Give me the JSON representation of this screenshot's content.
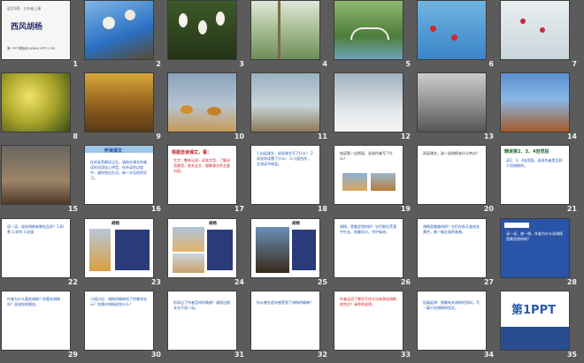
{
  "slides": [
    {
      "num": "1",
      "title": "西风胡杨",
      "top": "语文S版 · 五年级上册",
      "url": "第一PPT模板网-WWW.1PPT.COM"
    },
    {
      "num": "2"
    },
    {
      "num": "3"
    },
    {
      "num": "4"
    },
    {
      "num": "5"
    },
    {
      "num": "6"
    },
    {
      "num": "7"
    },
    {
      "num": "8"
    },
    {
      "num": "9"
    },
    {
      "num": "10"
    },
    {
      "num": "11"
    },
    {
      "num": "12"
    },
    {
      "num": "13"
    },
    {
      "num": "14"
    },
    {
      "num": "15"
    },
    {
      "num": "16",
      "head": "听读课文",
      "text": "在听录音朗读之后，请你在课文的难读的词语加上拼音，在听读的过程中，请你划出生词，每一次无扰的学习。"
    },
    {
      "num": "17",
      "head": "根据自读课文，看：",
      "text": "生字：整体认知，读准字音，了解词语意思，联系全文，理解课文的主要内容。"
    },
    {
      "num": "18",
      "text": "1.自读课文，说说课文写了什么？ 2.说说你读懂了什么？ 3.小组合作，交流读书体会。"
    },
    {
      "num": "19",
      "text": "快读第一自然段，说说作者写了什么？"
    },
    {
      "num": "20",
      "text": "再读课文，说一说胡杨有什么特点？"
    },
    {
      "num": "21",
      "head": "精读第2、3、4自然段",
      "text": "读2、3、4自然段，说说作者是怎样介绍胡杨的。"
    },
    {
      "num": "22",
      "text": "读一读，说说胡杨有哪些品质？1.耐寒 2.耐旱 3.坚强"
    },
    {
      "num": "23",
      "head": "胡杨"
    },
    {
      "num": "24",
      "head": "胡杨"
    },
    {
      "num": "25",
      "head": "胡杨"
    },
    {
      "num": "26",
      "text": "胡杨，是最坚韧的树！它们能在荒漠中生长，抵御风沙，守护绿洲。"
    },
    {
      "num": "27",
      "text": "胡杨是最美的树！它们在秋天变成金黄色，像一幅壮丽的画卷。"
    },
    {
      "num": "28",
      "text": "读一读，想一想，作者为什么说胡杨是最坚韧的树？"
    },
    {
      "num": "29",
      "text": "作者为什么喜欢胡杨？你喜欢胡杨吗？说说你的理由。"
    },
    {
      "num": "30",
      "text": "小组讨论：胡杨的精神给了你哪些启示？你想对胡杨说些什么？"
    },
    {
      "num": "31",
      "text": "你读出了作者怎样的情感？请找出相关句子读一读。"
    },
    {
      "num": "32",
      "text": "你从哪些语句感受到了胡杨的精神？"
    },
    {
      "num": "33",
      "text": "作者运用了哪些写作方法来表现胡杨的特点？请举例说明。"
    },
    {
      "num": "34",
      "text": "拓展延伸：搜集有关胡杨的资料，写一篇介绍胡杨的短文。"
    },
    {
      "num": "35",
      "brand": "第1PPT"
    }
  ]
}
